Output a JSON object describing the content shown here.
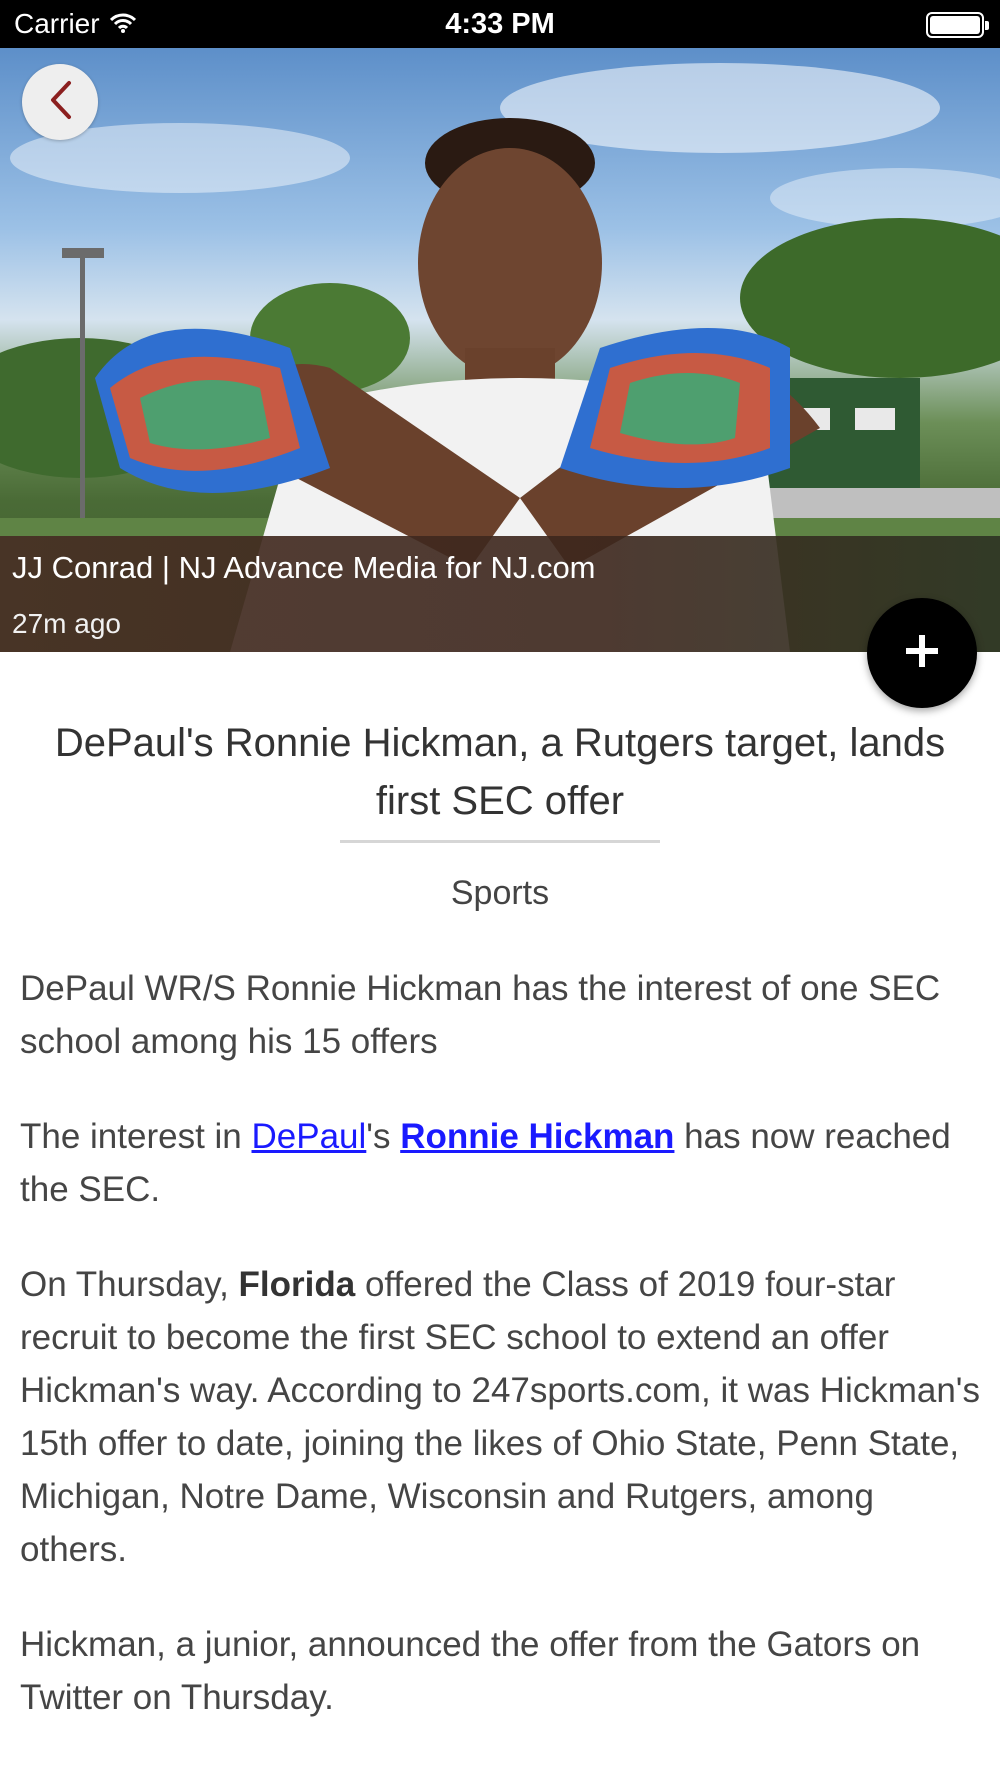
{
  "status_bar": {
    "carrier": "Carrier",
    "time": "4:33 PM"
  },
  "hero": {
    "photo_credit": "JJ Conrad | NJ Advance Media for NJ.com",
    "time_ago": "27m ago"
  },
  "article": {
    "headline": "DePaul's Ronnie Hickman, a Rutgers target, lands first SEC offer",
    "category": "Sports",
    "p1": "DePaul WR/S Ronnie Hickman has the interest of one SEC school among his 15 offers",
    "p2": {
      "before": "The interest in ",
      "link1": "DePaul",
      "mid": "'s ",
      "link2": "Ronnie Hickman",
      "after": " has now reached the SEC."
    },
    "p3": {
      "before": "On Thursday, ",
      "bold": "Florida",
      "after": " offered the Class of 2019 four-star recruit to become the first SEC school to extend an offer Hickman's way. According to 247sports.com, it was Hickman's 15th offer to date, joining the likes of Ohio State, Penn State, Michigan, Notre Dame, Wisconsin and Rutgers, among others."
    },
    "p4": "Hickman, a junior, announced the offer from the Gators on Twitter on Thursday."
  },
  "icons": {
    "back": "chevron-left-icon",
    "fab": "plus-icon",
    "wifi": "wifi-icon",
    "battery": "battery-icon"
  },
  "colors": {
    "back_chevron": "#8b1f1f",
    "link": "#1a1aff",
    "fab": "#000000"
  }
}
